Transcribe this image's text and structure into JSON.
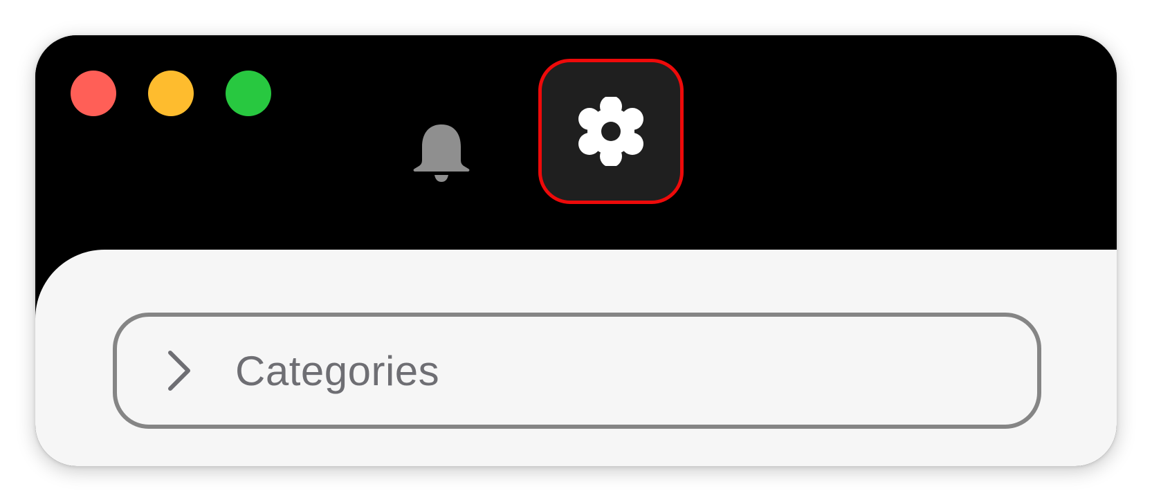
{
  "window": {
    "traffic_lights": {
      "close_color": "#ff5f57",
      "minimize_color": "#febc2e",
      "maximize_color": "#28c840"
    }
  },
  "toolbar": {
    "notifications_icon": "bell-icon",
    "settings_icon": "gear-icon",
    "settings_highlight_color": "#ee0a0a"
  },
  "sidebar": {
    "sections": [
      {
        "label": "Categories",
        "icon": "chevron-right-icon",
        "expanded": false
      }
    ]
  }
}
